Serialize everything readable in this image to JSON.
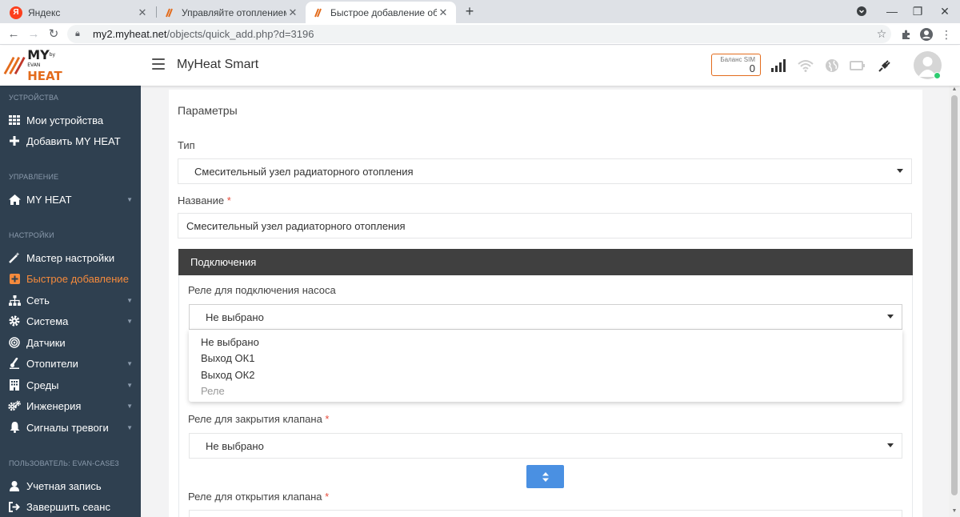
{
  "browser": {
    "tabs": [
      {
        "title": "Яндекс",
        "favicon": "yandex-favicon"
      },
      {
        "title": "Управляйте отоплением из люб",
        "favicon": "myheat-favicon"
      },
      {
        "title": "Быстрое добавление оборудов",
        "favicon": "myheat-favicon",
        "active": true
      }
    ],
    "url_host": "my2.myheat.net",
    "url_path": "/objects/quick_add.php?d=3196"
  },
  "header": {
    "logo_my": "MY",
    "logo_heat": "HEAT",
    "logo_by": "by EVAN",
    "title": "MyHeat Smart",
    "sim_label": "Баланс SIM",
    "sim_value": "0",
    "status_color": "#2ecc71",
    "accent_color": "#e36c1d"
  },
  "sidebar": {
    "sections": [
      "УСТРОЙСТВА",
      "УПРАВЛЕНИЕ",
      "НАСТРОЙКИ",
      "ПОЛЬЗОВАТЕЛЬ: EVAN-CASE3"
    ],
    "items": [
      {
        "label": "Мои устройства",
        "icon": "grid-icon"
      },
      {
        "label": "Добавить MY HEAT",
        "icon": "plus-icon"
      },
      {
        "label": "MY HEAT",
        "icon": "home-icon",
        "expandable": true
      },
      {
        "label": "Мастер настройки",
        "icon": "magic-wand-icon"
      },
      {
        "label": "Быстрое добавление",
        "icon": "plus-square-icon",
        "active": true
      },
      {
        "label": "Сеть",
        "icon": "sitemap-icon",
        "expandable": true
      },
      {
        "label": "Система",
        "icon": "cog-icon",
        "expandable": true
      },
      {
        "label": "Датчики",
        "icon": "bullseye-icon"
      },
      {
        "label": "Отопители",
        "icon": "thermometer-icon",
        "expandable": true
      },
      {
        "label": "Среды",
        "icon": "building-icon",
        "expandable": true
      },
      {
        "label": "Инженерия",
        "icon": "cogs-icon",
        "expandable": true
      },
      {
        "label": "Сигналы тревоги",
        "icon": "bell-icon",
        "expandable": true
      },
      {
        "label": "Учетная запись",
        "icon": "user-icon"
      },
      {
        "label": "Завершить сеанс",
        "icon": "sign-out-icon"
      }
    ]
  },
  "main": {
    "panel_title": "Параметры",
    "type_label": "Тип",
    "type_value": "Смесительный узел радиаторного отопления",
    "name_label": "Название",
    "name_required": "*",
    "name_value": "Смесительный узел радиаторного отопления",
    "connections_header": "Подключения",
    "pump_relay_label": "Реле для подключения насоса",
    "pump_relay_value": "Не выбрано",
    "dropdown_options": [
      "Не выбрано",
      "Выход ОК1",
      "Выход ОК2"
    ],
    "dropdown_group": "Реле",
    "valve_close_label": "Реле для закрытия клапана",
    "valve_close_required": "*",
    "valve_close_value": "Не выбрано",
    "valve_open_label": "Реле для открытия клапана",
    "valve_open_required": "*"
  }
}
